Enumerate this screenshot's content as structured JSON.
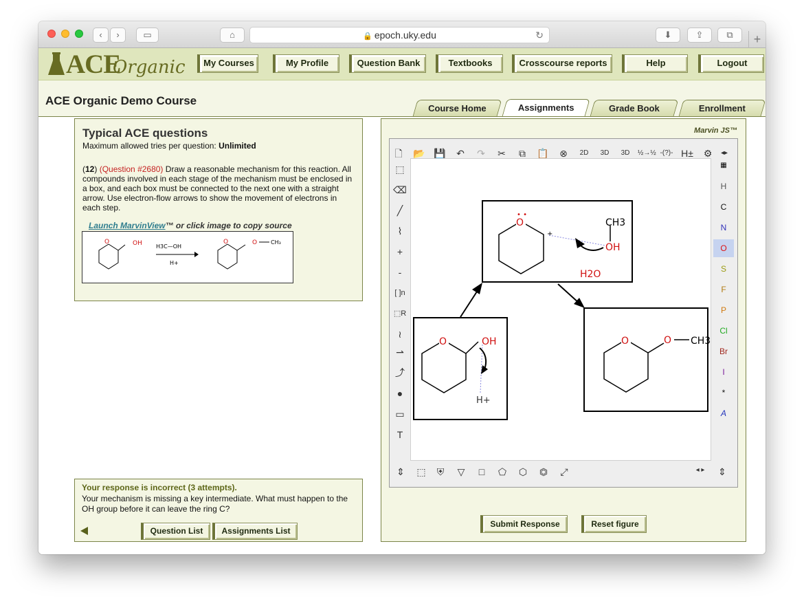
{
  "browser": {
    "url": "epoch.uky.edu"
  },
  "header": {
    "logo_main": "ACE",
    "logo_sub": "Organic",
    "nav": [
      {
        "label": "My Courses"
      },
      {
        "label": "My Profile"
      },
      {
        "label": "Question Bank"
      },
      {
        "label": "Textbooks"
      },
      {
        "label": "Crosscourse reports"
      },
      {
        "label": "Help"
      },
      {
        "label": "Logout"
      }
    ]
  },
  "course": {
    "title": "ACE Organic Demo Course",
    "tabs": [
      {
        "label": "Course Home",
        "active": false
      },
      {
        "label": "Assignments",
        "active": true
      },
      {
        "label": "Grade Book",
        "active": false
      },
      {
        "label": "Enrollment",
        "active": false
      }
    ]
  },
  "question": {
    "heading": "Typical ACE questions",
    "tries_label": "Maximum allowed tries per question:",
    "tries_value": "Unlimited",
    "number": "12",
    "qid": "(Question #2680)",
    "text": "Draw a reasonable mechanism for this reaction. All compounds involved in each stage of the mechanism must be enclosed in a box, and each box must be connected to the next one with a straight arrow. Use electron-flow arrows to show the movement of electrons in each step.",
    "launch_link": "Launch MarvinView",
    "launch_suffix": "™ or click image to copy source",
    "reagent_top": "H3C—OH",
    "reagent_bottom": "H+"
  },
  "feedback": {
    "heading": "Your response is incorrect (3 attempts).",
    "message": "Your mechanism is missing a key intermediate. What must happen to the OH group before it can leave the ring C?",
    "buttons": [
      {
        "label": "Question List"
      },
      {
        "label": "Assignments List"
      }
    ]
  },
  "marvin": {
    "title": "Marvin JS™",
    "elements": [
      "H",
      "C",
      "N",
      "O",
      "S",
      "F",
      "P",
      "Cl",
      "Br",
      "I",
      "*",
      "A"
    ],
    "element_colors": [
      "#555555",
      "#111111",
      "#3333bb",
      "#dd1111",
      "#9a9a10",
      "#b07a10",
      "#d07a10",
      "#22aa22",
      "#a0281e",
      "#7a1a9a",
      "#111111",
      "#2233bb"
    ],
    "selected_element": "O",
    "top_tools": [
      "new-doc",
      "open",
      "save",
      "undo",
      "redo",
      "cut",
      "copy",
      "paste",
      "zoom",
      "2D",
      "3D",
      "3D-rotate",
      "reaction",
      "query",
      "H±",
      "settings"
    ],
    "canvas_labels": {
      "ch3": "CH3",
      "oh": "OH",
      "h2o": "H2O",
      "h_plus": "H+",
      "o": "O",
      "ch3_right": "CH3"
    }
  },
  "actions": [
    {
      "label": "Submit Response"
    },
    {
      "label": "Reset figure"
    }
  ],
  "colors": {
    "header_bg": "#dfe6bd",
    "panel_bg": "#f4f6e3",
    "accent": "#6e7539",
    "error": "#c52222"
  }
}
